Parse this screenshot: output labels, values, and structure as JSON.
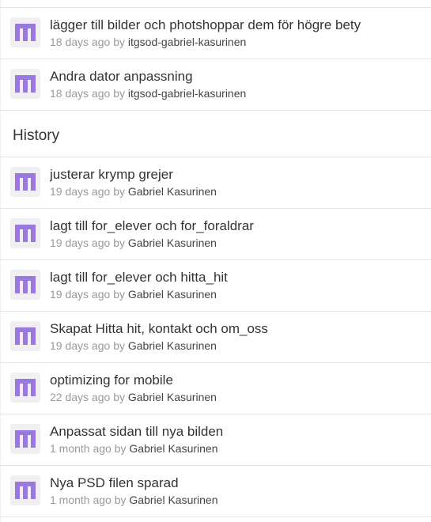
{
  "avatar_color": "#9b78e0",
  "avatar_bg": "#f0f0f2",
  "top_commits": [
    {
      "message": "lägger till bilder och photshoppar dem för högre bety",
      "time": "18 days ago",
      "by": "by",
      "author": "itgsod-gabriel-kasurinen",
      "avatar_icon": "identicon-avatar-icon"
    },
    {
      "message": "Andra dator anpassning",
      "time": "18 days ago",
      "by": "by",
      "author": "itgsod-gabriel-kasurinen",
      "avatar_icon": "identicon-avatar-icon"
    }
  ],
  "history": {
    "title": "History",
    "commits": [
      {
        "message": "justerar krymp grejer",
        "time": "19 days ago",
        "by": "by",
        "author": "Gabriel Kasurinen"
      },
      {
        "message": "lagt till for_elever och for_foraldrar",
        "time": "19 days ago",
        "by": "by",
        "author": "Gabriel Kasurinen"
      },
      {
        "message": "lagt till for_elever och hitta_hit",
        "time": "19 days ago",
        "by": "by",
        "author": "Gabriel Kasurinen"
      },
      {
        "message": "Skapat Hitta hit, kontakt och om_oss",
        "time": "19 days ago",
        "by": "by",
        "author": "Gabriel Kasurinen"
      },
      {
        "message": "optimizing for mobile",
        "time": "22 days ago",
        "by": "by",
        "author": "Gabriel Kasurinen"
      },
      {
        "message": "Anpassat sidan till nya bilden",
        "time": "1 month ago",
        "by": "by",
        "author": "Gabriel Kasurinen"
      },
      {
        "message": "Nya PSD filen sparad",
        "time": "1 month ago",
        "by": "by",
        "author": "Gabriel Kasurinen"
      }
    ]
  }
}
